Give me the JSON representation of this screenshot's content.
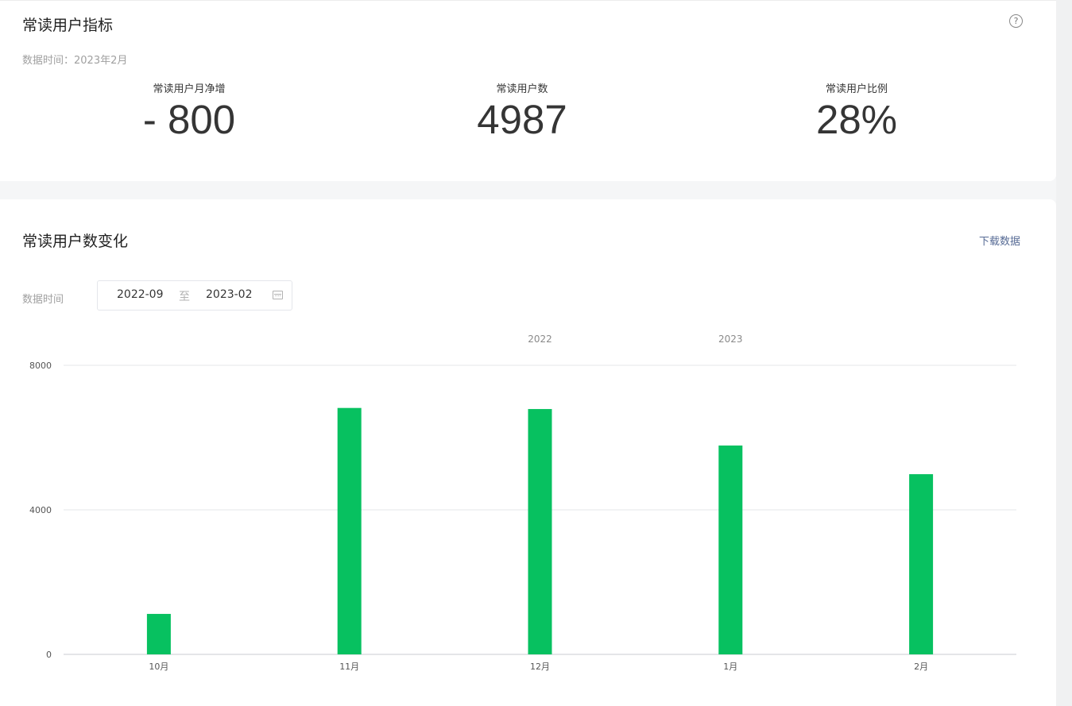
{
  "metrics_card": {
    "title": "常读用户指标",
    "help_icon": "question-circle-icon",
    "data_time": "数据时间：2023年2月",
    "items": [
      {
        "label": "常读用户月净增",
        "value": "- 800"
      },
      {
        "label": "常读用户数",
        "value": "4987"
      },
      {
        "label": "常读用户比例",
        "value": "28%"
      }
    ]
  },
  "chart_card": {
    "title": "常读用户数变化",
    "download_label": "下载数据",
    "filter": {
      "label": "数据时间",
      "start": "2022-09",
      "separator": "至",
      "end": "2023-02",
      "icon": "calendar-icon"
    }
  },
  "colors": {
    "bar": "#07c160",
    "link": "#576b95",
    "text": "#353535",
    "muted": "#a0a0a0"
  },
  "chart_data": {
    "type": "bar",
    "categories": [
      "10月",
      "11月",
      "12月",
      "1月",
      "2月"
    ],
    "values": [
      1120,
      6820,
      6790,
      5780,
      4987
    ],
    "year_labels": [
      {
        "label": "2022",
        "category_index": 2
      },
      {
        "label": "2023",
        "category_index": 3
      }
    ],
    "yticks": [
      0,
      4000,
      8000
    ],
    "ylim": [
      0,
      8000
    ],
    "grid": true,
    "legend": "none"
  }
}
